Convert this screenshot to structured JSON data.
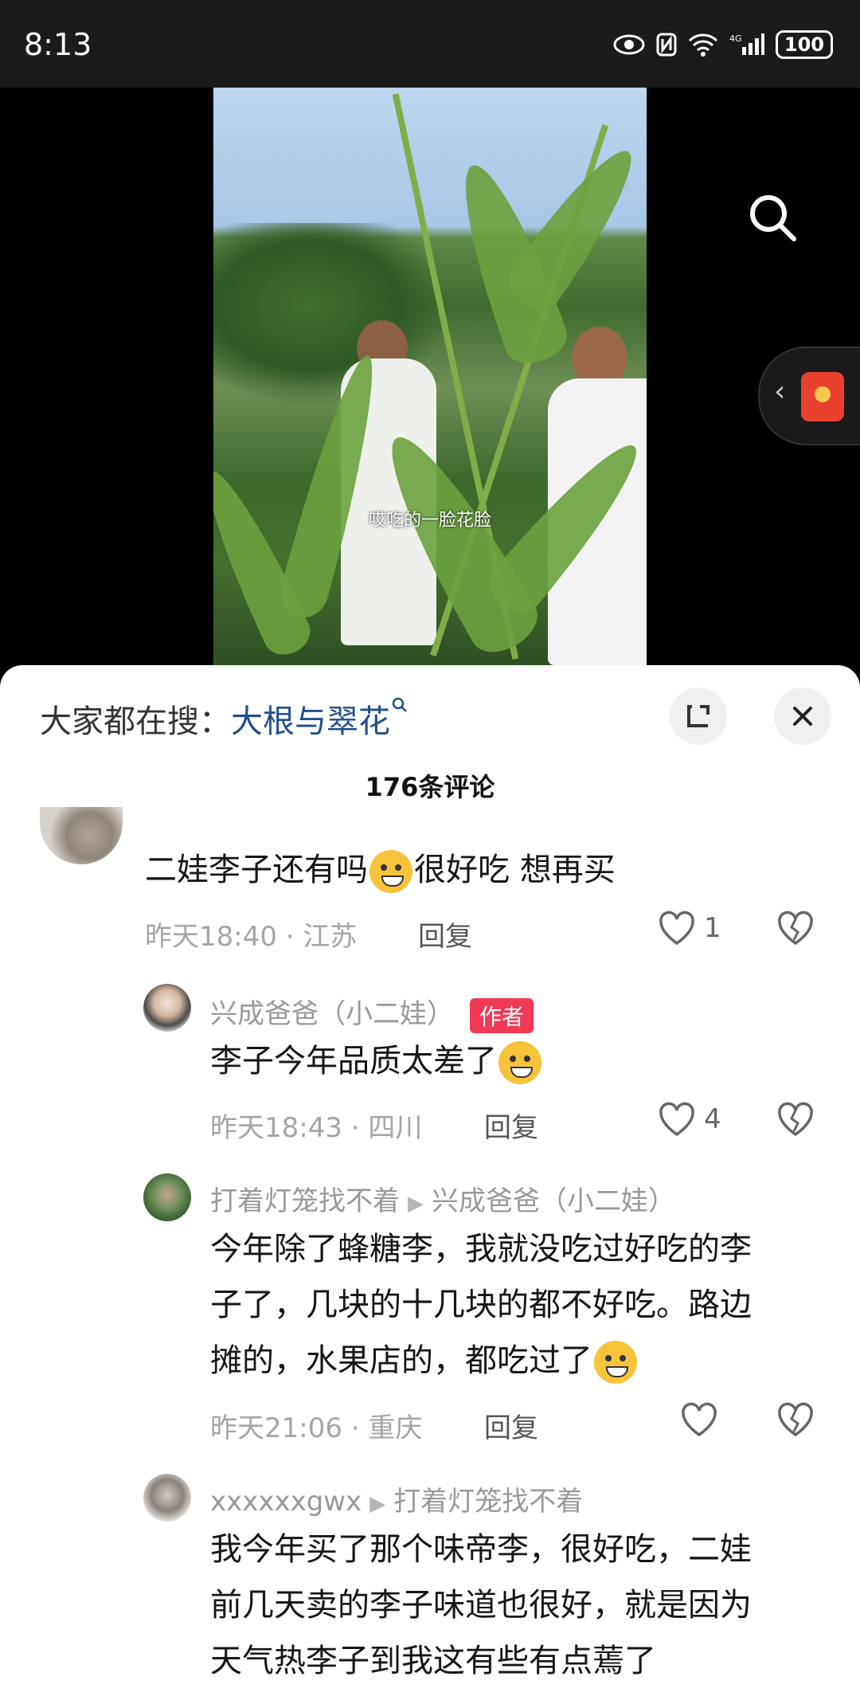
{
  "status_bar": {
    "time": "8:13",
    "battery": "100"
  },
  "video": {
    "caption": "哎吃的一脸花脸"
  },
  "sheet": {
    "hot_prefix": "大家都在搜：",
    "hot_term": "大根与翠花",
    "comment_count": "176条评论"
  },
  "comments": [
    {
      "text": "二娃李子还有吗",
      "text_after": "很好吃 想再买",
      "time": "昨天18:40",
      "location": "江苏",
      "reply": "回复",
      "likes": "1"
    },
    {
      "name": "兴成爸爸（小二娃）",
      "badge": "作者",
      "text": "李子今年品质太差了",
      "time": "昨天18:43",
      "location": "四川",
      "reply": "回复",
      "likes": "4"
    },
    {
      "name": "打着灯笼找不着",
      "reply_to": "兴成爸爸（小二娃）",
      "line1": "今年除了蜂糖李，我就没吃过好吃的李",
      "line2": "子了，几块的十几块的都不好吃。路边",
      "line3": "摊的，水果店的，都吃过了",
      "time": "昨天21:06",
      "location": "重庆",
      "reply": "回复"
    },
    {
      "name": "xxxxxxgwx",
      "reply_to": "打着灯笼找不着",
      "line1": "我今年买了那个味帝李，很好吃，二娃",
      "line2": "前几天卖的李子味道也很好，就是因为",
      "line3": "天气热李子到我这有些有点蔫了"
    }
  ],
  "colors": {
    "accent_link": "#1d4f8f",
    "author_badge": "#f03a55"
  }
}
